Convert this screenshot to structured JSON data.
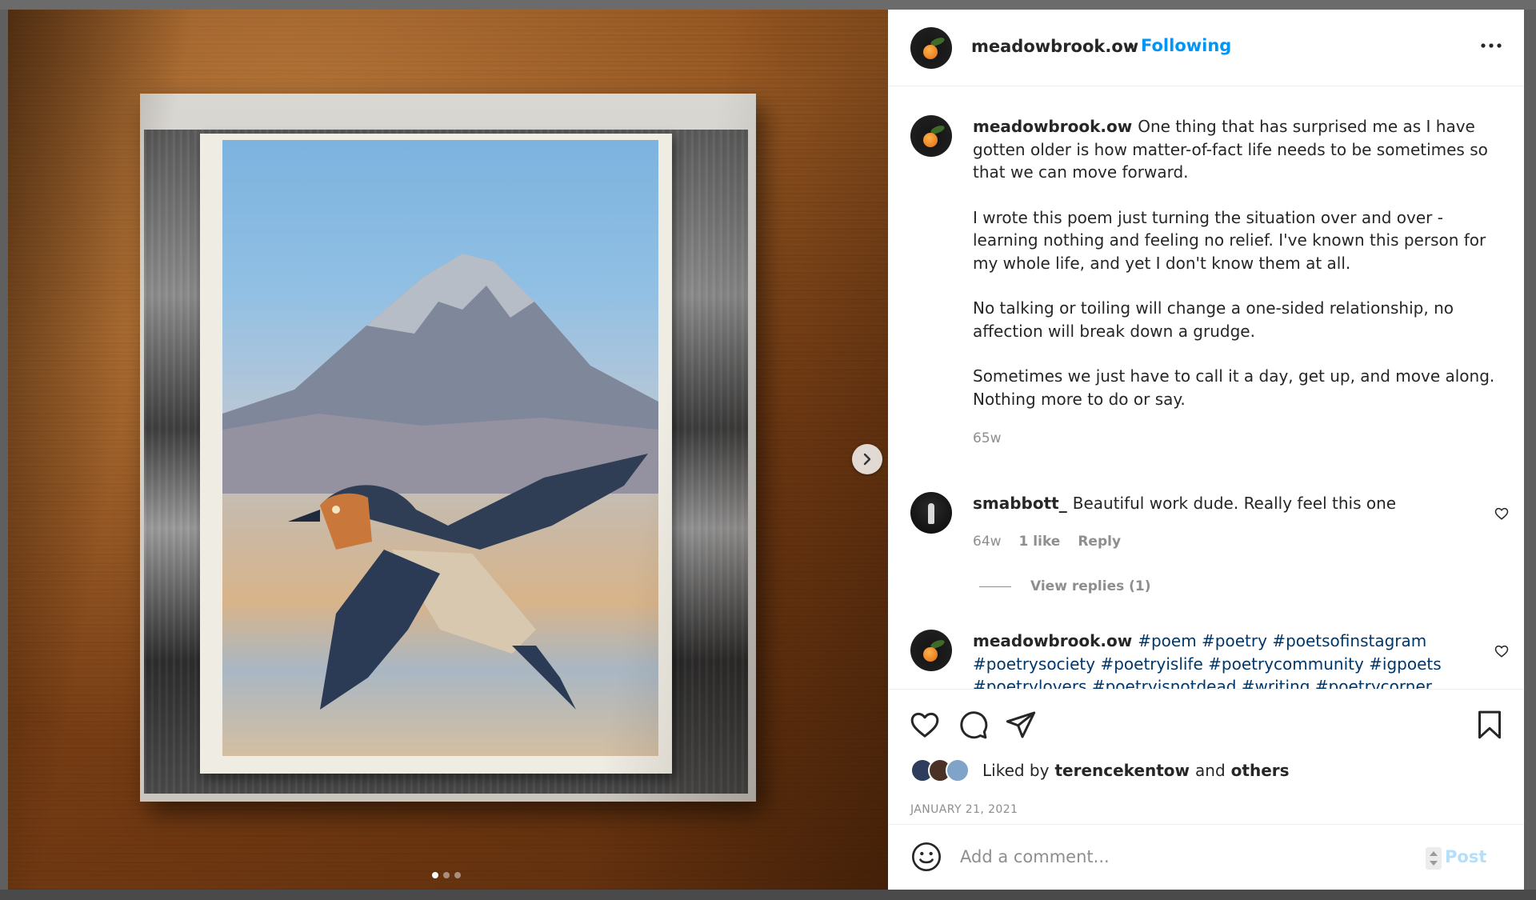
{
  "post": {
    "username": "meadowbrook.ow",
    "separator": "•",
    "follow_status": "Following",
    "more_icon": "more-horizontal-icon"
  },
  "media": {
    "next_icon": "chevron-right-icon",
    "slide_count": 3,
    "active_slide": 1
  },
  "caption": {
    "username": "meadowbrook.ow",
    "paragraphs": [
      "One thing that has surprised me as I have gotten older is how matter-of-fact life needs to be sometimes so that we can move forward.",
      "I wrote this poem just turning the situation over and over - learning nothing and feeling no relief. I've known this person for my whole life, and yet I don't know them at all.",
      "No talking or toiling will change a one-sided relationship, no affection will break down a grudge.",
      "Sometimes we just have to call it a day, get up, and move along. Nothing more to do or say."
    ],
    "age": "65w"
  },
  "comments": [
    {
      "username": "smabbott_",
      "text": "Beautiful work dude. Really feel this one",
      "age": "64w",
      "likes": "1 like",
      "reply_label": "Reply",
      "view_replies": "View replies (1)"
    },
    {
      "username": "meadowbrook.ow",
      "hashtags": "#poem #poetry #poetsofinstagram #poetrysociety #poetryislife #poetrycommunity #igpoets #poetrylovers #poetryisnotdead #writing #poetrycorner"
    }
  ],
  "actions": {
    "like_icon": "heart-icon",
    "comment_icon": "comment-icon",
    "share_icon": "send-icon",
    "save_icon": "bookmark-icon"
  },
  "likes": {
    "prefix": "Liked by",
    "user": "terencekentow",
    "conjunction": "and",
    "others": "others"
  },
  "date": "JANUARY 21, 2021",
  "add_comment": {
    "emoji_icon": "emoji-icon",
    "placeholder": "Add a comment...",
    "post_label": "Post"
  },
  "colors": {
    "accent": "#0095f6",
    "muted_text": "#8e8e8e",
    "post_disabled": "#b2dffc",
    "hashtag": "#00376b"
  }
}
